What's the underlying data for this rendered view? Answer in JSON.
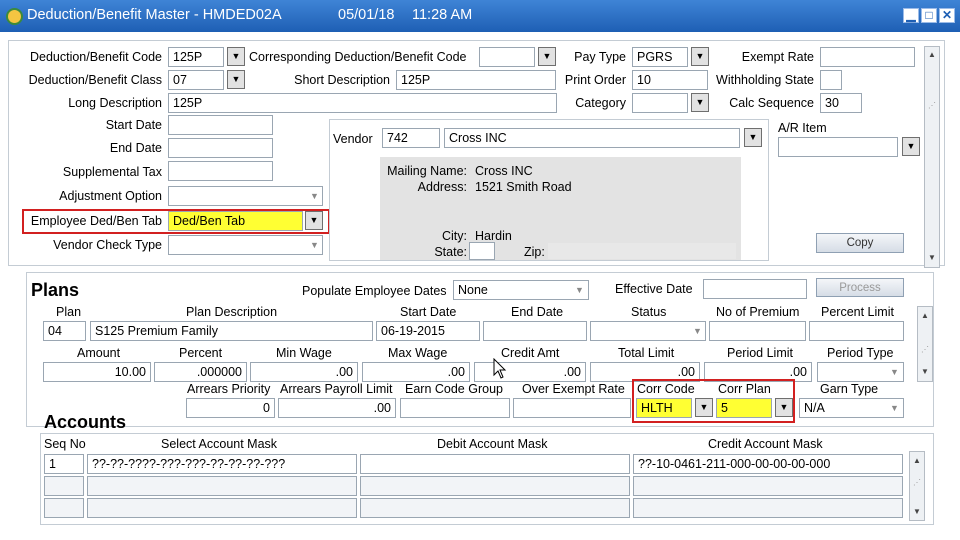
{
  "window": {
    "title": "Deduction/Benefit Master - HMDED02A",
    "date": "05/01/18",
    "time": "11:28 AM"
  },
  "header": {
    "ded_ben_code_label": "Deduction/Benefit Code",
    "ded_ben_code": "125P",
    "corr_ded_code_label": "Corresponding Deduction/Benefit Code",
    "corr_ded_code": "",
    "pay_type_label": "Pay Type",
    "pay_type": "PGRS",
    "exempt_rate_label": "Exempt Rate",
    "exempt_rate": "",
    "ded_ben_class_label": "Deduction/Benefit Class",
    "ded_ben_class": "07",
    "short_desc_label": "Short Description",
    "short_desc": "125P",
    "print_order_label": "Print Order",
    "print_order": "10",
    "withholding_state_label": "Withholding State",
    "withholding_state": "",
    "long_desc_label": "Long Description",
    "long_desc": "125P",
    "category_label": "Category",
    "category": "",
    "calc_sequence_label": "Calc Sequence",
    "calc_sequence": "30",
    "start_date_label": "Start Date",
    "start_date": "",
    "end_date_label": "End Date",
    "end_date": "",
    "supp_tax_label": "Supplemental Tax",
    "supp_tax": "",
    "adj_option_label": "Adjustment Option",
    "adj_option": "",
    "emp_ded_tab_label": "Employee Ded/Ben Tab",
    "emp_ded_tab": "Ded/Ben Tab",
    "vendor_check_type_label": "Vendor Check Type",
    "vendor_check_type": "",
    "ar_item_label": "A/R Item",
    "ar_item": "",
    "copy_button": "Copy"
  },
  "vendor": {
    "label": "Vendor",
    "code": "742",
    "name": "Cross INC",
    "mailing_name_label": "Mailing Name:",
    "mailing_name": "Cross INC",
    "address_label": "Address:",
    "address": "1521 Smith Road",
    "city_label": "City:",
    "city": "Hardin",
    "state_label": "State:",
    "state": "",
    "zip_label": "Zip:",
    "zip": ""
  },
  "plans": {
    "title": "Plans",
    "populate_label": "Populate Employee Dates",
    "populate_value": "None",
    "effective_date_label": "Effective Date",
    "effective_date": "",
    "process_button": "Process",
    "columns1": {
      "plan": "Plan",
      "plan_desc": "Plan Description",
      "start_date": "Start Date",
      "end_date": "End Date",
      "status": "Status",
      "no_of_premium": "No of Premium",
      "percent_limit": "Percent Limit"
    },
    "row1": {
      "plan": "04",
      "plan_desc": "S125 Premium Family",
      "start_date": "06-19-2015",
      "end_date": "",
      "status": "",
      "no_of_premium": "",
      "percent_limit": ""
    },
    "columns2": {
      "amount": "Amount",
      "percent": "Percent",
      "min_wage": "Min Wage",
      "max_wage": "Max Wage",
      "credit_amt": "Credit Amt",
      "total_limit": "Total Limit",
      "period_limit": "Period Limit",
      "period_type": "Period Type"
    },
    "row2": {
      "amount": "10.00",
      "percent": ".000000",
      "min_wage": ".00",
      "max_wage": ".00",
      "credit_amt": ".00",
      "total_limit": ".00",
      "period_limit": ".00",
      "period_type": ""
    },
    "columns3": {
      "arrears_priority": "Arrears Priority",
      "arrears_payroll_limit": "Arrears Payroll Limit",
      "earn_code_group": "Earn Code Group",
      "over_exempt_rate": "Over Exempt Rate",
      "corr_code": "Corr Code",
      "corr_plan": "Corr Plan",
      "garn_type": "Garn Type"
    },
    "row3": {
      "arrears_priority": "0",
      "arrears_payroll_limit": ".00",
      "earn_code_group": "",
      "over_exempt_rate": "",
      "corr_code": "HLTH",
      "corr_plan": "5",
      "garn_type": "N/A"
    }
  },
  "accounts": {
    "title": "Accounts",
    "columns": {
      "seq_no": "Seq No",
      "select_mask": "Select Account Mask",
      "debit_mask": "Debit Account Mask",
      "credit_mask": "Credit Account Mask"
    },
    "rows": [
      {
        "seq_no": "1",
        "select_mask": "??-??-????-???-???-??-??-??-???",
        "debit_mask": "",
        "credit_mask": "??-10-0461-211-000-00-00-00-000"
      }
    ]
  },
  "colors": {
    "title_bar": "#1e5fb4",
    "highlight": "#ffff33",
    "callout": "#d22020"
  }
}
